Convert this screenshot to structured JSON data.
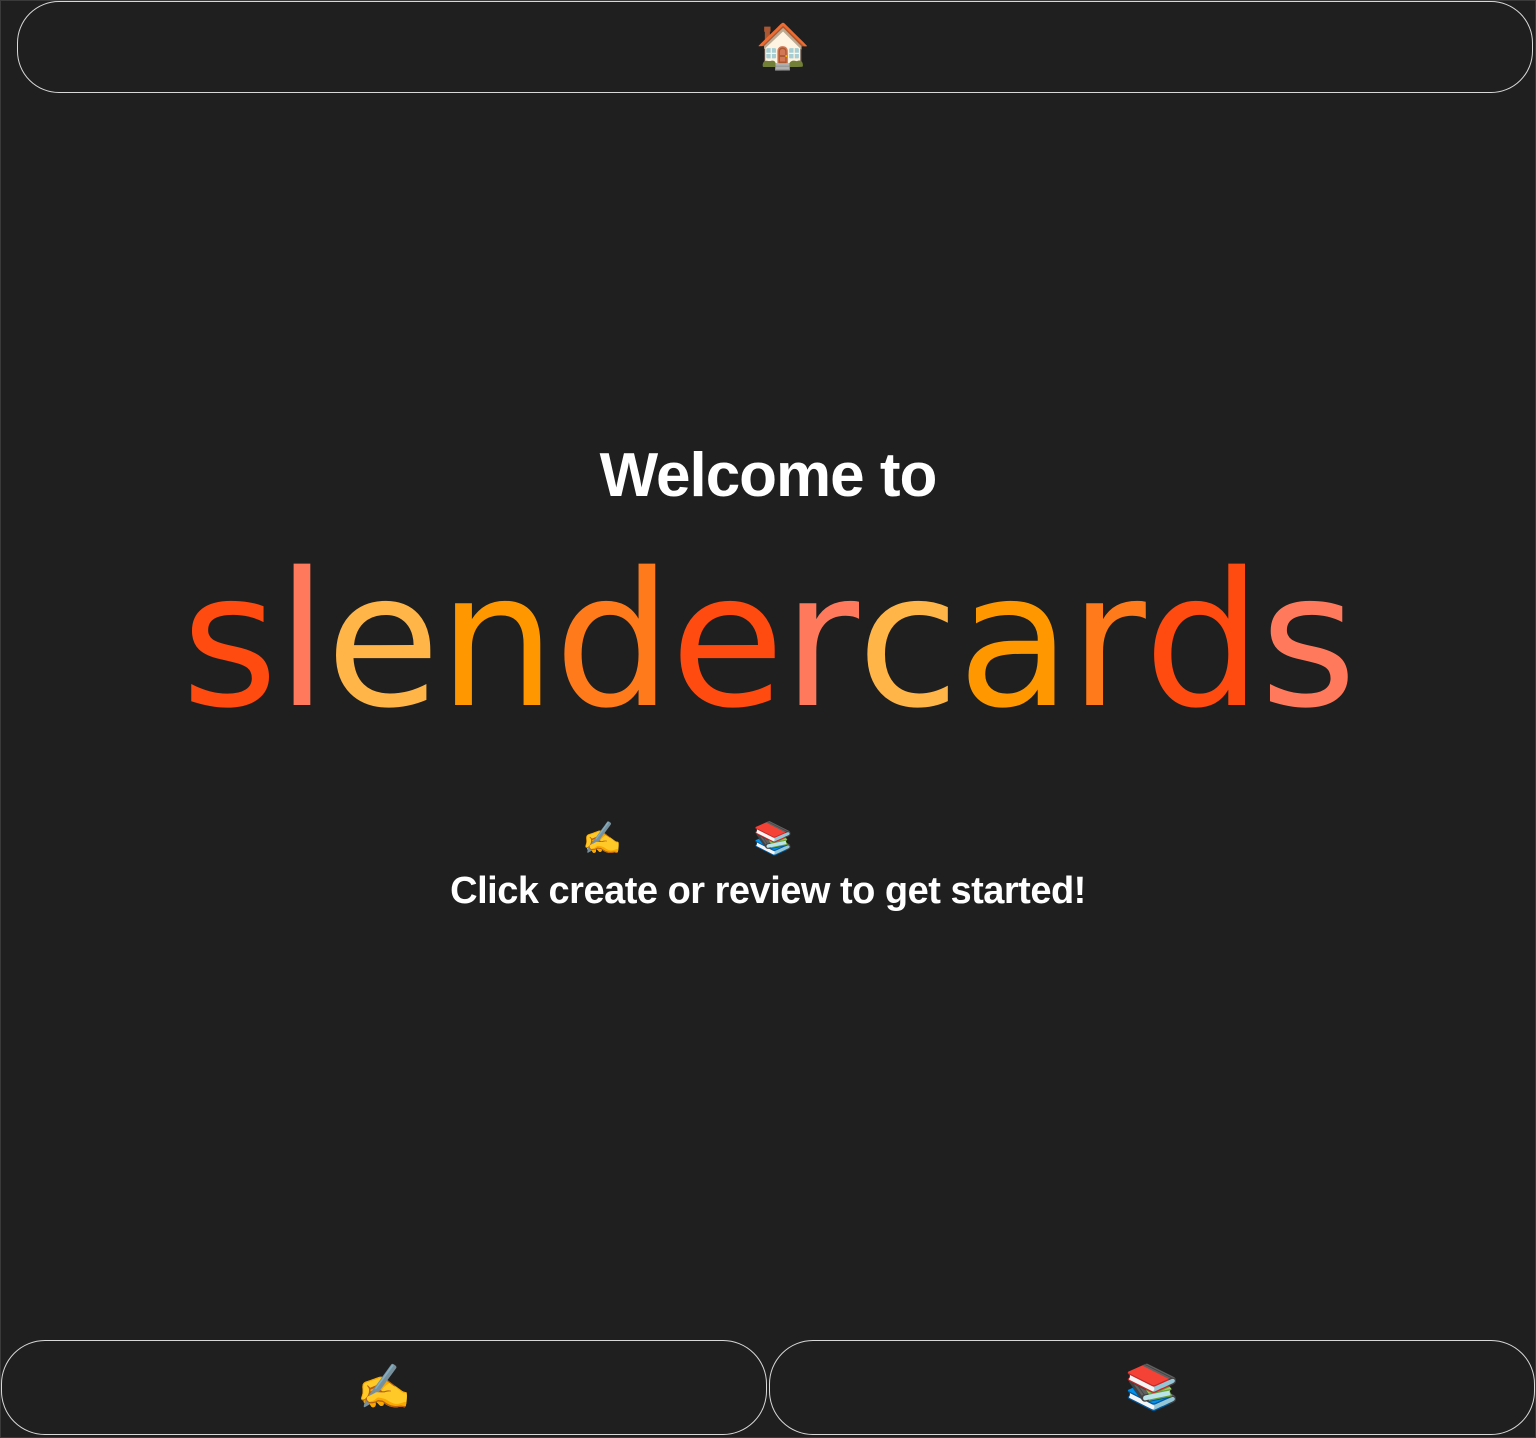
{
  "nav": {
    "home_icon": "🏠",
    "home_icon_name": "house-icon"
  },
  "welcome": {
    "heading": "Welcome to",
    "brand_letters": [
      {
        "char": "s",
        "color": "#FF4A10"
      },
      {
        "char": "l",
        "color": "#FF7A5C"
      },
      {
        "char": "e",
        "color": "#FFB547"
      },
      {
        "char": "n",
        "color": "#FF9800"
      },
      {
        "char": "d",
        "color": "#FF7A1A"
      },
      {
        "char": "e",
        "color": "#FF4A10"
      },
      {
        "char": "r",
        "color": "#FF7A5C"
      },
      {
        "char": "c",
        "color": "#FFB547"
      },
      {
        "char": "a",
        "color": "#FF9800"
      },
      {
        "char": "r",
        "color": "#FF7A1A"
      },
      {
        "char": "d",
        "color": "#FF4A10"
      },
      {
        "char": "s",
        "color": "#FF7A5C"
      }
    ],
    "create_icon": "✍️",
    "review_icon": "📚",
    "hint": "Click create or review to get started!"
  },
  "bottom_nav": {
    "create_icon": "✍️",
    "review_icon": "📚"
  },
  "colors": {
    "background": "#1f1f1f",
    "border": "#d8d8d8",
    "text": "#ffffff"
  }
}
